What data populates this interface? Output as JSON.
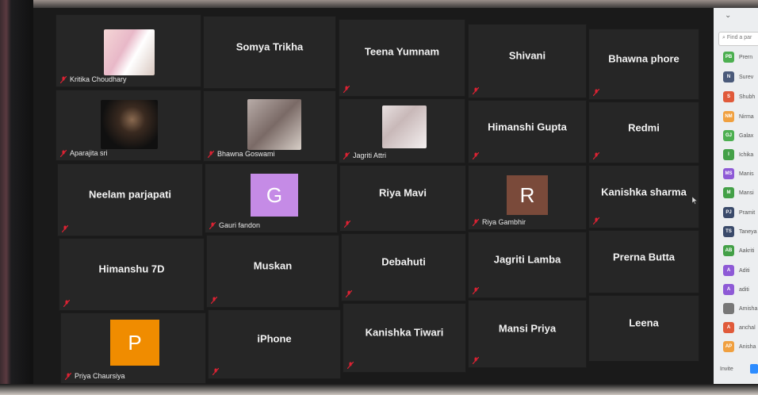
{
  "gallery": {
    "tiles": [
      {
        "id": "kritika",
        "label": "Kritika Choudhary",
        "center_name": "",
        "has_video": true
      },
      {
        "id": "somya",
        "label": "",
        "center_name": "Somya Trikha",
        "has_video": false
      },
      {
        "id": "teena",
        "label": "",
        "center_name": "Teena Yumnam",
        "has_video": false
      },
      {
        "id": "shivani",
        "label": "",
        "center_name": "Shivani",
        "has_video": false
      },
      {
        "id": "bhawna_phore",
        "label": "",
        "center_name": "Bhawna phore",
        "has_video": false
      },
      {
        "id": "aparajita",
        "label": "Aparajita sri",
        "center_name": "",
        "has_video": true
      },
      {
        "id": "bhawna_goswami",
        "label": "Bhawna Goswami",
        "center_name": "",
        "has_video": true
      },
      {
        "id": "jagriti_attri",
        "label": "Jagriti Attri",
        "center_name": "",
        "has_video": true
      },
      {
        "id": "himanshi",
        "label": "",
        "center_name": "Himanshi Gupta",
        "has_video": false
      },
      {
        "id": "redmi",
        "label": "",
        "center_name": "Redmi",
        "has_video": false
      },
      {
        "id": "neelam",
        "label": "",
        "center_name": "Neelam parjapati",
        "has_video": false
      },
      {
        "id": "gauri",
        "label": "Gauri fandon",
        "center_name": "",
        "avatar_letter": "G",
        "avatar_color": "#c58be6"
      },
      {
        "id": "riya_mavi",
        "label": "",
        "center_name": "Riya Mavi",
        "has_video": false
      },
      {
        "id": "riya_gambhir",
        "label": "Riya Gambhir",
        "center_name": "",
        "avatar_letter": "R",
        "avatar_color": "#7a4a3a"
      },
      {
        "id": "kanishka_sharma",
        "label": "",
        "center_name": "Kanishka sharma",
        "has_video": false
      },
      {
        "id": "himanshu",
        "label": "",
        "center_name": "Himanshu 7D",
        "has_video": false
      },
      {
        "id": "muskan",
        "label": "",
        "center_name": "Muskan",
        "has_video": false
      },
      {
        "id": "debahuti",
        "label": "",
        "center_name": "Debahuti",
        "has_video": false
      },
      {
        "id": "jagriti_lamba",
        "label": "",
        "center_name": "Jagriti  Lamba",
        "has_video": false
      },
      {
        "id": "prerna",
        "label": "",
        "center_name": "Prerna Butta",
        "has_video": false
      },
      {
        "id": "priya",
        "label": "Priya Chaursiya",
        "center_name": "",
        "avatar_letter": "P",
        "avatar_color": "#f08c00"
      },
      {
        "id": "iphone",
        "label": "",
        "center_name": "iPhone",
        "has_video": false
      },
      {
        "id": "kanishka_tiwari",
        "label": "",
        "center_name": "Kanishka Tiwari",
        "has_video": false
      },
      {
        "id": "mansi_priya",
        "label": "",
        "center_name": "Mansi Priya",
        "has_video": false
      },
      {
        "id": "leena",
        "label": "",
        "center_name": "Leena",
        "has_video": false
      }
    ]
  },
  "participants_panel": {
    "search_placeholder": "Find a par",
    "invite_label": "Invite",
    "items": [
      {
        "initials": "PB",
        "name": "Prern",
        "color": "#4caf50"
      },
      {
        "initials": "N",
        "name": "Surev",
        "color": "#4a5a7a"
      },
      {
        "initials": "S",
        "name": "Shubh",
        "color": "#e05a3a"
      },
      {
        "initials": "NM",
        "name": "Nirma",
        "color": "#f0a040"
      },
      {
        "initials": "GJ",
        "name": "Galax",
        "color": "#4caf50"
      },
      {
        "initials": "I",
        "name": "Ichika",
        "color": "#43a047"
      },
      {
        "initials": "MS",
        "name": "Manis",
        "color": "#8e5ad6"
      },
      {
        "initials": "M",
        "name": "Mansi",
        "color": "#43a047"
      },
      {
        "initials": "PJ",
        "name": "Pramit",
        "color": "#3a4a6a"
      },
      {
        "initials": "TS",
        "name": "Taneya",
        "color": "#3a4a6a"
      },
      {
        "initials": "AB",
        "name": "Aakriti",
        "color": "#43a047"
      },
      {
        "initials": "A",
        "name": "Aditi",
        "color": "#8e5ad6"
      },
      {
        "initials": "A",
        "name": "aditi",
        "color": "#8e5ad6"
      },
      {
        "initials": "",
        "name": "Amisha",
        "color": "#777777"
      },
      {
        "initials": "A",
        "name": "anchal",
        "color": "#e05a3a"
      },
      {
        "initials": "AP",
        "name": "Anisha",
        "color": "#f0a040"
      }
    ]
  }
}
